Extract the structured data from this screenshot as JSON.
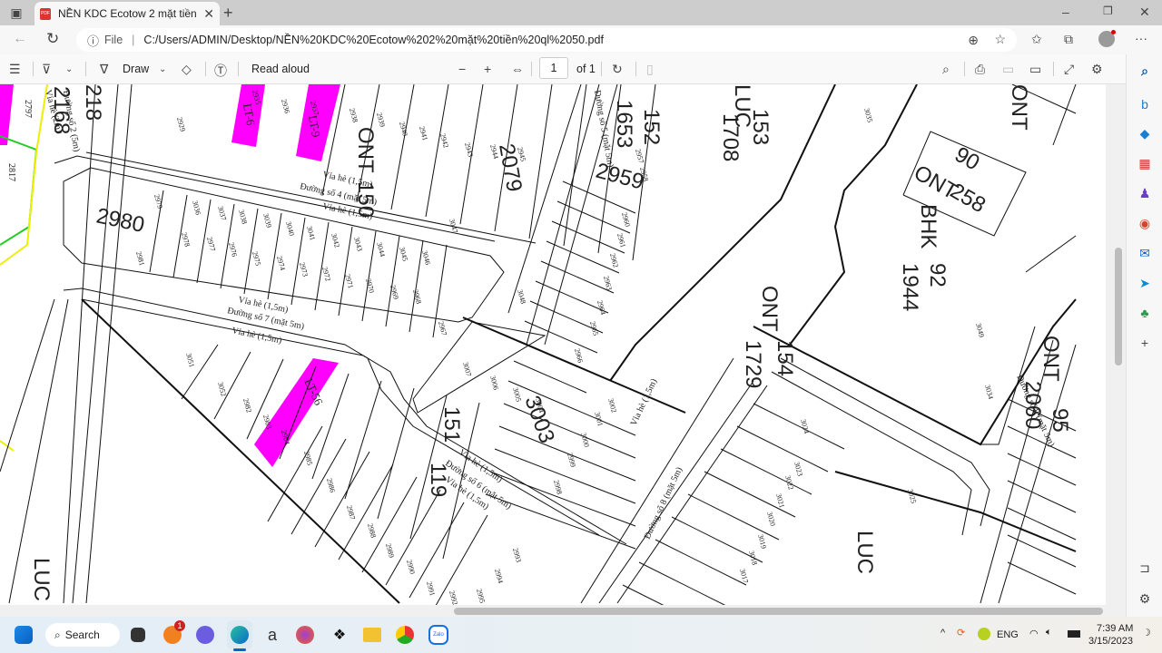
{
  "browser": {
    "tab_title": "NỀN KDC Ecotow 2 mặt tiền ql 50",
    "url_scheme": "File",
    "url": "C:/Users/ADMIN/Desktop/NỀN%20KDC%20Ecotow%202%20mặt%20tiền%20ql%2050.pdf"
  },
  "pdf_toolbar": {
    "draw": "Draw",
    "read_aloud": "Read aloud",
    "page_current": "1",
    "page_total": "of 1"
  },
  "map": {
    "parcel_labels": [
      "2929",
      "2935",
      "2936",
      "2937",
      "2938",
      "2939",
      "2940",
      "2941",
      "2942",
      "2943",
      "2944",
      "2945",
      "2979",
      "3036",
      "3037",
      "3038",
      "3039",
      "3040",
      "3041",
      "3042",
      "3043",
      "3044",
      "3045",
      "3046",
      "3047",
      "2978",
      "2977",
      "2976",
      "2975",
      "2974",
      "2973",
      "2972",
      "2971",
      "2970",
      "2969",
      "2968",
      "2967",
      "2981",
      "3048",
      "2957",
      "2958",
      "2960",
      "2961",
      "2962",
      "2963",
      "2964",
      "2965",
      "2966",
      "3035",
      "3049",
      "3051",
      "3052",
      "2982",
      "2983",
      "2984",
      "2985",
      "2986",
      "2987",
      "2988",
      "2989",
      "2990",
      "2991",
      "2992",
      "2993",
      "2994",
      "2995",
      "3007",
      "3006",
      "3005",
      "3004",
      "3002",
      "3001",
      "3000",
      "2999",
      "2998",
      "3024",
      "3023",
      "3022",
      "3021",
      "3020",
      "3019",
      "3018",
      "3017",
      "3025",
      "3034",
      "2797",
      "2817"
    ],
    "lots": [
      "LT-6",
      "LT-9",
      "LT-56"
    ],
    "big_labels": {
      "a": "2980",
      "b": "2079",
      "c": "2959",
      "d": "3003",
      "e": "ONT",
      "f": "150",
      "g": "LUC",
      "h": "153",
      "i": "1708",
      "j": "ONT",
      "k": "90",
      "l": "258",
      "m": "BHK",
      "n": "92",
      "o": "1944",
      "p": "ONT",
      "q": "154",
      "r": "1729",
      "s": "ONT",
      "t": "151",
      "u": "119",
      "v": "LUC",
      "w": "LUC",
      "x": "ONT",
      "y": "95",
      "z": "2060",
      "aa": "152",
      "ab": "1653",
      "ac": "218",
      "ad": "2168"
    },
    "roads": {
      "r4": "Đường số 4 (mặt 5m)",
      "r7": "Đường số 7 (mặt 5m)",
      "r2": "Đường số 2 (5m)",
      "r5": "Đường số 5 (mặt 5m)",
      "r6": "Đường số 6 (mặt 5m)",
      "r8": "Đường số 8 (mặt 5m)",
      "vh": "Vỉa hè (1,5m)",
      "vh2": "Vỉa hè (2m)"
    }
  },
  "taskbar": {
    "search": "Search",
    "badge": "1",
    "lang": "ENG",
    "time": "7:39 AM",
    "date": "3/15/2023",
    "zalo": "Zalo"
  },
  "colors": {
    "lot_highlight": "#ff00ff",
    "boundary_green": "#22cc22",
    "boundary_yellow": "#f0f000",
    "edge_accent": "#0c59a4"
  }
}
